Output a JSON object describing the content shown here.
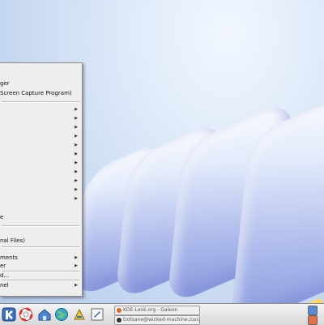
{
  "menu": {
    "items": [
      {
        "label": "ger",
        "submenu": false
      },
      {
        "label": "Screen Capture Program)",
        "submenu": false
      },
      {
        "label": "",
        "submenu": true
      },
      {
        "label": "",
        "submenu": true
      },
      {
        "label": "",
        "submenu": true
      },
      {
        "label": "",
        "submenu": true
      },
      {
        "label": "",
        "submenu": true
      },
      {
        "label": "",
        "submenu": true
      },
      {
        "label": "",
        "submenu": true
      },
      {
        "label": "",
        "submenu": true
      },
      {
        "label": "",
        "submenu": true
      },
      {
        "label": "",
        "submenu": true
      },
      {
        "label": "",
        "submenu": true
      },
      {
        "label": "e",
        "submenu": false
      },
      {
        "label": "nal Files)",
        "submenu": false
      },
      {
        "label": "ments",
        "submenu": true
      },
      {
        "label": "er",
        "submenu": true
      },
      {
        "label": "d...",
        "submenu": false
      },
      {
        "label": "nel",
        "submenu": true
      }
    ],
    "arrow_glyph": "▶"
  },
  "taskbar": {
    "tasks": [
      {
        "title": "KDE-Look.org - Galeon",
        "icon": "galeon-icon"
      },
      {
        "title": "trotsane@wicked-machine:/usr/share",
        "icon": "terminal-icon"
      }
    ],
    "launchers": [
      "kde-start-icon",
      "lifebuoy-help-icon",
      "home-folder-icon",
      "konqueror-globe-icon",
      "control-center-icon",
      "editor-icon"
    ]
  },
  "colors": {
    "menu_bg": "#eeeeee",
    "taskbar_bg": "#e4e4e4",
    "wallpaper_sky": "#c4d6f0",
    "tray_orange": "#e0704a",
    "tray_blue": "#5a8ad6"
  }
}
